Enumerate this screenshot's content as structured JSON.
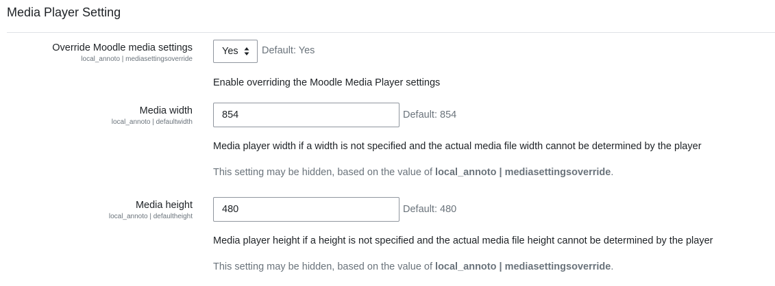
{
  "section": {
    "title": "Media Player Setting"
  },
  "settings": [
    {
      "label": "Override Moodle media settings",
      "identifier": "local_annoto | mediasettingsoverride",
      "control": "select",
      "value": "Yes",
      "default": "Default: Yes",
      "description": "Enable overriding the Moodle Media Player settings"
    },
    {
      "label": "Media width",
      "identifier": "local_annoto | defaultwidth",
      "control": "text",
      "value": "854",
      "default": "Default: 854",
      "description": "Media player width if a width is not specified and the actual media file width cannot be determined by the player",
      "hint_prefix": "This setting may be hidden, based on the value of ",
      "hint_ref": "local_annoto | mediasettingsoverride",
      "hint_suffix": "."
    },
    {
      "label": "Media height",
      "identifier": "local_annoto | defaultheight",
      "control": "text",
      "value": "480",
      "default": "Default: 480",
      "description": "Media player height if a height is not specified and the actual media file height cannot be determined by the player",
      "hint_prefix": "This setting may be hidden, based on the value of ",
      "hint_ref": "local_annoto | mediasettingsoverride",
      "hint_suffix": "."
    }
  ],
  "icons": {
    "select_arrow": "sort-arrows-icon"
  },
  "colors": {
    "text": "#1d2125",
    "muted": "#6a737b",
    "border": "#8f959e",
    "divider": "#dee2e6"
  }
}
